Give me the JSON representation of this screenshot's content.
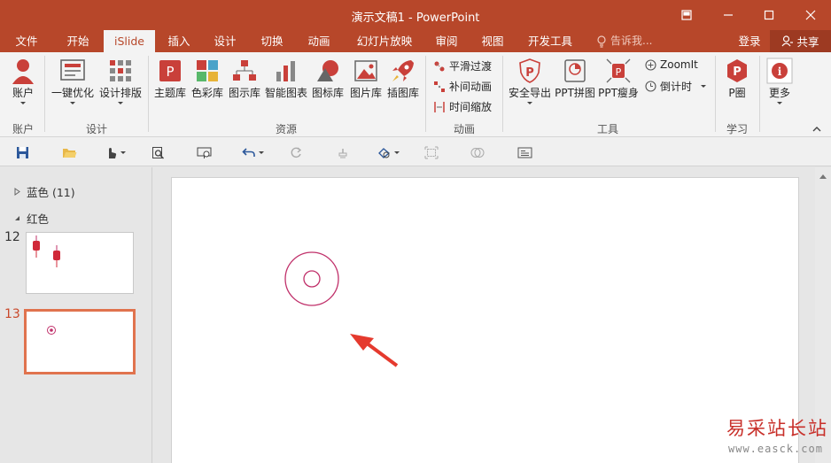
{
  "window": {
    "title": "演示文稿1 - PowerPoint"
  },
  "tabs": [
    "文件",
    "开始",
    "iSlide",
    "插入",
    "设计",
    "切换",
    "动画",
    "幻灯片放映",
    "审阅",
    "视图",
    "开发工具"
  ],
  "active_tab": "iSlide",
  "tell_me": "告诉我...",
  "account": {
    "login": "登录",
    "share": "共享"
  },
  "ribbon": {
    "groups": {
      "account": "账户",
      "design": "设计",
      "resources": "资源",
      "animation": "动画",
      "tools": "工具",
      "learn": "学习"
    },
    "account_button": "账户",
    "design_buttons": [
      "一键优化",
      "设计排版"
    ],
    "resource_buttons": [
      "主题库",
      "色彩库",
      "图示库",
      "智能图表",
      "图标库",
      "图片库",
      "插图库"
    ],
    "animation_buttons": [
      "平滑过渡",
      "补间动画",
      "时间缩放"
    ],
    "tool_buttons": [
      "安全导出",
      "PPT拼图",
      "PPT瘦身"
    ],
    "tool_small": [
      "ZoomIt",
      "倒计时"
    ],
    "learn_button": "P圈",
    "more_button": "更多"
  },
  "slide_panel": {
    "sections": [
      {
        "name": "蓝色 (11)",
        "collapsed": true
      },
      {
        "name": "红色",
        "collapsed": false
      }
    ],
    "thumbnails": [
      {
        "number": "12",
        "selected": false
      },
      {
        "number": "13",
        "selected": true
      }
    ]
  },
  "watermark": {
    "cn": "易采站长站",
    "url": "www.easck.com"
  },
  "colors": {
    "accent": "#b7472a",
    "ring": "#c0306a",
    "arrow": "#e53a2e",
    "selection": "#e0734e"
  },
  "icons": [
    "restore-icon",
    "minimize-icon",
    "maximize-icon",
    "close-icon",
    "lightbulb-icon",
    "user-icon",
    "save-icon",
    "open-folder-icon",
    "touch-mode-icon",
    "preview-icon",
    "present-icon",
    "undo-icon",
    "redo-icon",
    "format-painter-icon",
    "shape-icon",
    "align-icon",
    "merge-icon",
    "textbox-icon"
  ]
}
